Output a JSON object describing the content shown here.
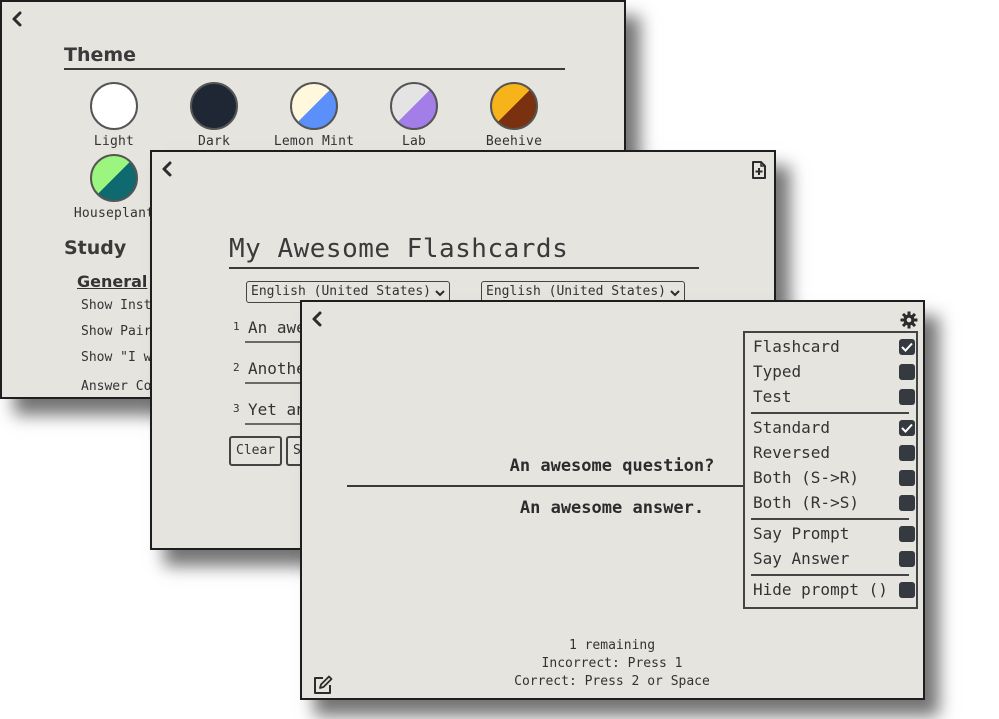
{
  "settings": {
    "theme_title": "Theme",
    "themes": [
      {
        "label": "Light",
        "colors": [
          "#ffffff",
          "#ffffff"
        ]
      },
      {
        "label": "Dark",
        "colors": [
          "#1e2733",
          "#1e2733"
        ]
      },
      {
        "label": "Lemon Mint",
        "colors": [
          "#fff8dc",
          "#5b8ff9"
        ]
      },
      {
        "label": "Lab",
        "colors": [
          "#e4e4e4",
          "#a37ee8"
        ]
      },
      {
        "label": "Beehive",
        "colors": [
          "#f6b41a",
          "#7a3110"
        ]
      },
      {
        "label": "Houseplant",
        "colors": [
          "#9cf57e",
          "#0f6a6f"
        ]
      }
    ],
    "study_title": "Study",
    "general_title": "General",
    "study_options": [
      "Show Inst",
      "Show Pair",
      "Show \"I w",
      "Answer Co"
    ]
  },
  "editor": {
    "deck_title": "My Awesome Flashcards",
    "prompt_language": "English (United States)",
    "answer_language": "English (United States)",
    "cards": [
      {
        "num": "1",
        "text": "An awe"
      },
      {
        "num": "2",
        "text": "Anothe"
      },
      {
        "num": "3",
        "text": "Yet an"
      }
    ],
    "clear_label": "Clear",
    "second_button_label": "S"
  },
  "study": {
    "question": "An awesome question?",
    "answer": "An awesome answer.",
    "remaining": "1 remaining",
    "incorrect_hint": "Incorrect: Press 1",
    "correct_hint": "Correct: Press 2 or Space",
    "menu_groups": [
      [
        {
          "label": "Flashcard",
          "checked": true
        },
        {
          "label": "Typed",
          "checked": false
        },
        {
          "label": "Test",
          "checked": false
        }
      ],
      [
        {
          "label": "Standard",
          "checked": true
        },
        {
          "label": "Reversed",
          "checked": false
        },
        {
          "label": "Both (S->R)",
          "checked": false
        },
        {
          "label": "Both (R->S)",
          "checked": false
        }
      ],
      [
        {
          "label": "Say Prompt",
          "checked": false
        },
        {
          "label": "Say Answer",
          "checked": false
        }
      ],
      [
        {
          "label": "Hide prompt ()",
          "checked": false
        }
      ]
    ]
  },
  "colors": {
    "window_bg": "#e6e4df",
    "border": "#1e1e1e",
    "checkbox": "#343a40"
  }
}
